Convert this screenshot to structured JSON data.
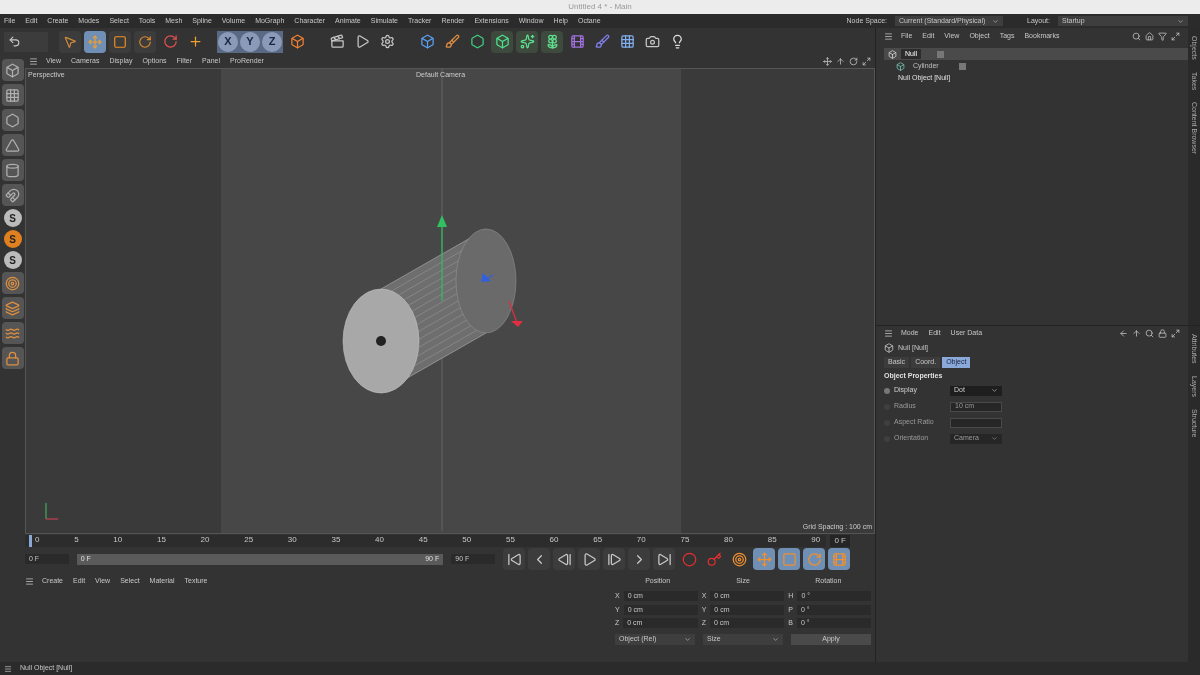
{
  "window": {
    "title": "Untitled 4 * - Main"
  },
  "menu": [
    "File",
    "Edit",
    "Create",
    "Modes",
    "Select",
    "Tools",
    "Mesh",
    "Spline",
    "Volume",
    "MoGraph",
    "Character",
    "Animate",
    "Simulate",
    "Tracker",
    "Render",
    "Extensions",
    "Window",
    "Help",
    "Octane"
  ],
  "node_space": {
    "label": "Node Space:",
    "value": "Current (Standard/Physical)"
  },
  "layout": {
    "label": "Layout:",
    "value": "Startup"
  },
  "tools": [
    {
      "selected": false
    },
    {
      "selected": true
    },
    {
      "selected": false
    },
    {
      "selected": false
    }
  ],
  "axis_locks": [
    {
      "label": "X",
      "on": true
    },
    {
      "label": "Y",
      "on": true
    },
    {
      "label": "Z",
      "on": true
    }
  ],
  "left_toolbar_letters": [
    "S",
    "S",
    "S"
  ],
  "viewport": {
    "menu": [
      "View",
      "Cameras",
      "Display",
      "Options",
      "Filter",
      "Panel",
      "ProRender"
    ],
    "view_name": "Perspective",
    "camera": "Default Camera",
    "grid_spacing": "Grid Spacing : 100 cm"
  },
  "timeline": {
    "ticks": [
      "0",
      "5",
      "10",
      "15",
      "20",
      "25",
      "30",
      "35",
      "40",
      "45",
      "50",
      "55",
      "60",
      "65",
      "70",
      "75",
      "80",
      "85",
      "90"
    ],
    "playhead": {
      "level": 0
    },
    "range": {
      "level": 1
    },
    "current_frame": "0 F",
    "start": "0 F",
    "range_start": "0 F",
    "range_end": "90 F",
    "end": "90 F"
  },
  "material_manager": {
    "menu": [
      "Create",
      "Edit",
      "View",
      "Select",
      "Material",
      "Texture"
    ]
  },
  "coordinates": {
    "headers": [
      "Position",
      "Size",
      "Rotation"
    ],
    "rows": [
      {
        "position_axis": "X",
        "position": "0 cm",
        "size_axis": "X",
        "size": "0 cm",
        "rotation_axis": "H",
        "rotation": "0 °"
      },
      {
        "position_axis": "Y",
        "position": "0 cm",
        "size_axis": "Y",
        "size": "0 cm",
        "rotation_axis": "P",
        "rotation": "0 °"
      },
      {
        "position_axis": "Z",
        "position": "0 cm",
        "size_axis": "Z",
        "size": "0 cm",
        "rotation_axis": "B",
        "rotation": "0 °"
      }
    ],
    "mode": "Object (Rel)",
    "size_mode": "Size",
    "apply": "Apply"
  },
  "object_manager": {
    "menu": [
      "File",
      "Edit",
      "View",
      "Object",
      "Tags",
      "Bookmarks"
    ],
    "tree": [
      {
        "name": "Null",
        "selected": true,
        "children": [
          {
            "name": "Cylinder",
            "selected": false
          }
        ]
      }
    ],
    "tooltip": "Null Object [Null]"
  },
  "side_tabs_top": [
    "Objects",
    "Takes",
    "Content Browser"
  ],
  "attributes": {
    "menu": [
      "Mode",
      "Edit",
      "User Data"
    ],
    "object": "Null [Null]",
    "tabs": [
      {
        "label": "Basic",
        "selected": false
      },
      {
        "label": "Coord.",
        "selected": false
      },
      {
        "label": "Object",
        "selected": true
      }
    ],
    "section": "Object Properties",
    "fields": [
      {
        "label": "Display",
        "value": "Dot",
        "kind": "dropdown",
        "disabled": false
      },
      {
        "label": "Radius",
        "value": "10 cm",
        "kind": "number",
        "disabled": true
      },
      {
        "label": "Aspect Ratio",
        "kind": "number",
        "disabled": true
      },
      {
        "label": "Orientation",
        "value": "Camera",
        "kind": "dropdown",
        "disabled": true
      }
    ]
  },
  "side_tabs_bottom": [
    "Attributes",
    "Layers",
    "Structure"
  ],
  "status_bar": "Null Object [Null]"
}
